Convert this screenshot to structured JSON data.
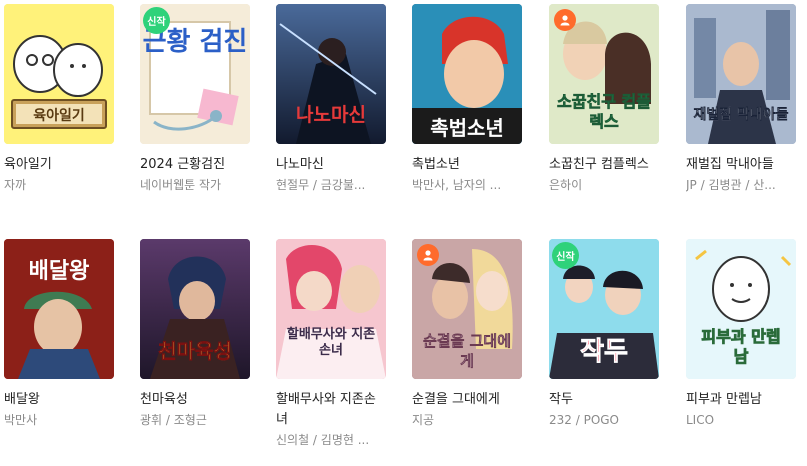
{
  "items": [
    {
      "title": "육아일기",
      "author": "자까",
      "cover_text": "육아일기",
      "bg": "#fff27a",
      "badge": ""
    },
    {
      "title": "2024 근황검진",
      "author": "네이버웹툰 작가",
      "cover_text": "근황 검진",
      "bg": "#f5ecd9",
      "badge": "신작"
    },
    {
      "title": "나노마신",
      "author": "현절무 / 금강불...",
      "cover_text": "나노마신",
      "bg": "#2a3b5c",
      "badge": ""
    },
    {
      "title": "촉법소년",
      "author": "박만사, 남자의 ...",
      "cover_text": "촉법소년",
      "bg": "#1a5c8a",
      "badge": ""
    },
    {
      "title": "소꿉친구 컴플렉스",
      "author": "은하이",
      "cover_text": "소꿉친구 컴플렉스",
      "bg": "#e9f2d6",
      "badge": "adult"
    },
    {
      "title": "재벌집 막내아들",
      "author": "JP / 김병관 / 산...",
      "cover_text": "재벌집 막내아들",
      "bg": "#8fa2bc",
      "badge": ""
    },
    {
      "title": "배달왕",
      "author": "박만사",
      "cover_text": "배달왕",
      "bg": "#b02a1e",
      "badge": ""
    },
    {
      "title": "천마육성",
      "author": "광휘 / 조형근",
      "cover_text": "천마육성",
      "bg": "#3a2b4e",
      "badge": ""
    },
    {
      "title": "할배무사와 지존손녀",
      "author": "신의철 / 김명현 ...",
      "cover_text": "할배무사와 지존손녀",
      "bg": "#f4b8c4",
      "badge": ""
    },
    {
      "title": "순결을 그대에게",
      "author": "지공",
      "cover_text": "순결을 그대에게",
      "bg": "#9a6b7a",
      "badge": "adult"
    },
    {
      "title": "작두",
      "author": "232 / POGO",
      "cover_text": "작두",
      "bg": "#7fd4e6",
      "badge": "신작"
    },
    {
      "title": "피부과 만렙남",
      "author": "LICO",
      "cover_text": "피부과 만렙남",
      "bg": "#e3f6fb",
      "badge": ""
    }
  ],
  "colors": {
    "new_badge": "#2fd27a",
    "adult_badge": "#ff6b2c",
    "title_text": "#222222",
    "author_text": "#8a8a8a"
  }
}
